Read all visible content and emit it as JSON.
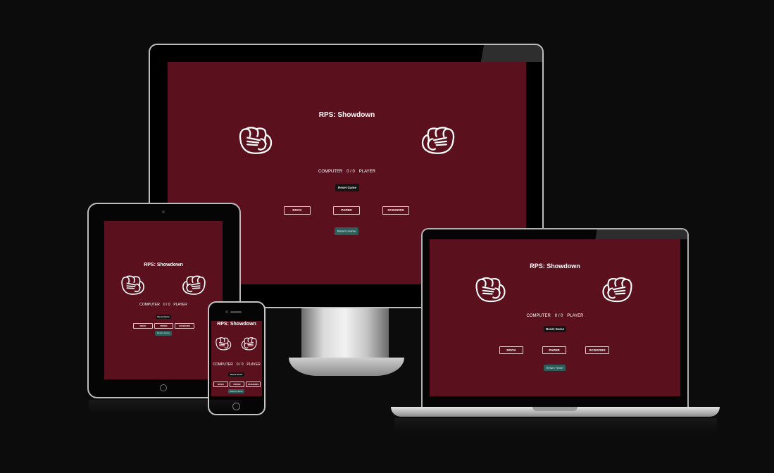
{
  "game": {
    "title": "RPS: Showdown",
    "score": {
      "computer_label": "COMPUTER",
      "value": "0 / 0",
      "player_label": "PLAYER"
    },
    "reset_label": "Reset Game",
    "choices": [
      "ROCK",
      "PAPER",
      "SCISSORS"
    ],
    "rules_label": "Return Home"
  },
  "colors": {
    "background": "#0c0c0d",
    "screen": "#5a111d",
    "reset_button": "#141414",
    "rules_button": "#2e5e5c"
  },
  "icons": {
    "fist": "fist-icon"
  }
}
